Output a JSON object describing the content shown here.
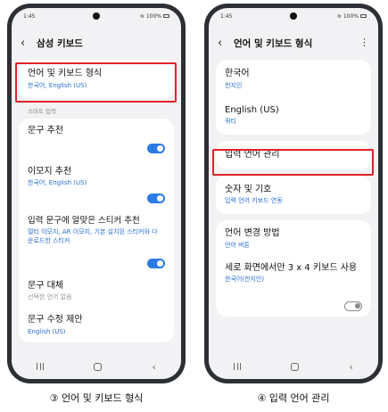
{
  "left": {
    "status": {
      "time": "1:45",
      "battery": "100%"
    },
    "title": "삼성 키보드",
    "items": [
      {
        "title": "언어 및 키보드 형식",
        "sub": "한국어, English (US)"
      }
    ],
    "section": "스마트 입력",
    "smart_items": [
      {
        "title": "문구 추천"
      },
      {
        "title": "이모지 추천",
        "sub": "한국어, English (US)"
      },
      {
        "title": "입력 문구에 알맞은 스티커 추천",
        "sub": "멀티 이모지, AR 이모지, 기본 설치된 스티커와 다운로드한 스티커"
      }
    ],
    "other_items": [
      {
        "title": "문구 대체",
        "sub": "선택한 언어 없음"
      },
      {
        "title": "문구 수정 제안",
        "sub": "English (US)"
      }
    ],
    "caption": "③ 언어 및 키보드 형식"
  },
  "right": {
    "status": {
      "time": "1:45",
      "battery": "100%"
    },
    "title": "언어 및 키보드 형식",
    "languages": [
      {
        "title": "한국어",
        "sub": "천지인"
      },
      {
        "title": "English (US)",
        "sub": "쿼티"
      }
    ],
    "manage": {
      "title": "입력 언어 관리"
    },
    "numbers": {
      "title": "숫자 및 기호",
      "sub": "입력 언어 키보드 연동"
    },
    "change": {
      "title": "언어 변경 방법",
      "sub": "언어 버튼"
    },
    "portrait": {
      "title": "세로 화면에서만 3 x 4 키보드 사용",
      "sub": "한국어(천지인)"
    },
    "caption": "④ 입력 언어 관리"
  },
  "colors": {
    "accent": "#2a7be4",
    "highlight": "#e2212a",
    "link": "#2a6fd1"
  },
  "icons": {
    "back": "back-arrow-icon",
    "more": "more-vert-icon",
    "recent": "recent-apps-icon",
    "home": "home-icon",
    "nav_back": "nav-back-icon"
  }
}
